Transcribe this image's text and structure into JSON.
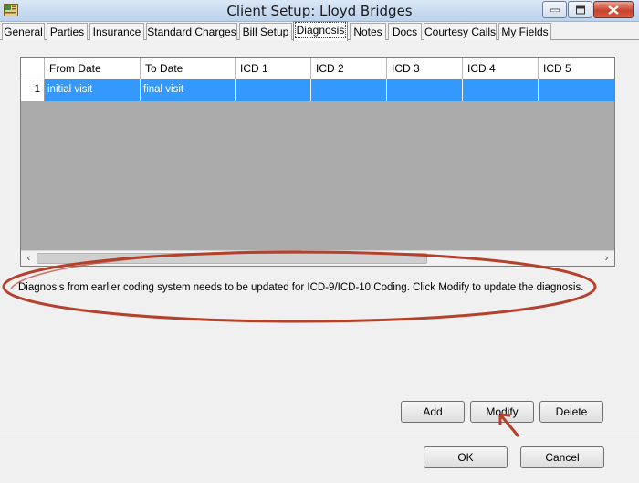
{
  "window": {
    "title": "Client Setup: Lloyd Bridges"
  },
  "tabs": [
    {
      "label": "General"
    },
    {
      "label": "Parties"
    },
    {
      "label": "Insurance"
    },
    {
      "label": "Standard Charges"
    },
    {
      "label": "Bill Setup"
    },
    {
      "label": "Diagnosis",
      "active": true
    },
    {
      "label": "Notes"
    },
    {
      "label": "Docs"
    },
    {
      "label": "Courtesy Calls"
    },
    {
      "label": "My Fields"
    }
  ],
  "grid": {
    "columns": [
      "From Date",
      "To Date",
      "ICD 1",
      "ICD 2",
      "ICD 3",
      "ICD 4",
      "ICD 5"
    ],
    "rows": [
      {
        "num": "1",
        "cells": [
          "initial visit",
          "final visit",
          "",
          "",
          "",
          "",
          ""
        ]
      }
    ]
  },
  "message": "Diagnosis from earlier coding system needs to be updated for ICD-9/ICD-10 Coding. Click Modify to update the diagnosis.",
  "buttons": {
    "add": "Add",
    "modify": "Modify",
    "delete": "Delete",
    "ok": "OK",
    "cancel": "Cancel"
  },
  "colors": {
    "selection": "#3399ff",
    "annotation": "#b5412c"
  }
}
